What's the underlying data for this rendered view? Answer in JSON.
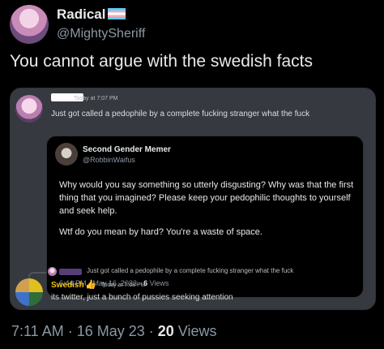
{
  "tweet": {
    "author_name": "Radical",
    "author_handle": "@MightySheriff",
    "text": "You cannot argue with the swedish facts",
    "timestamp": "7:11 AM · 16 May 23 · ",
    "views_count": "20",
    "views_label": " Views"
  },
  "discord": {
    "message1": {
      "time": "Today at 7:07 PM",
      "text": "Just got called  a pedophile by a complete fucking stranger what the fuck"
    },
    "embed": {
      "name": "Second Gender Memer",
      "handle": "@RobbinWaifus",
      "paragraph1": "Why would you say something so utterly disgusting? Why was that the first thing that you imagined? Please keep your pedophilic thoughts to yourself and seek help.",
      "paragraph2": "Wtf do you mean by hard? You're a waste of space.",
      "meta_time": "6:44 PM · May 16, 2023 · ",
      "meta_views_count": "6",
      "meta_views_label": " Views"
    },
    "reply_preview": "Just got called a pedophile by a complete fucking stranger what the fuck",
    "message2": {
      "author": "Swedish",
      "emoji": "👍",
      "time": "Today at 7:08 PM",
      "text": "its twitter, just a bunch of pussies seeking attention"
    }
  }
}
